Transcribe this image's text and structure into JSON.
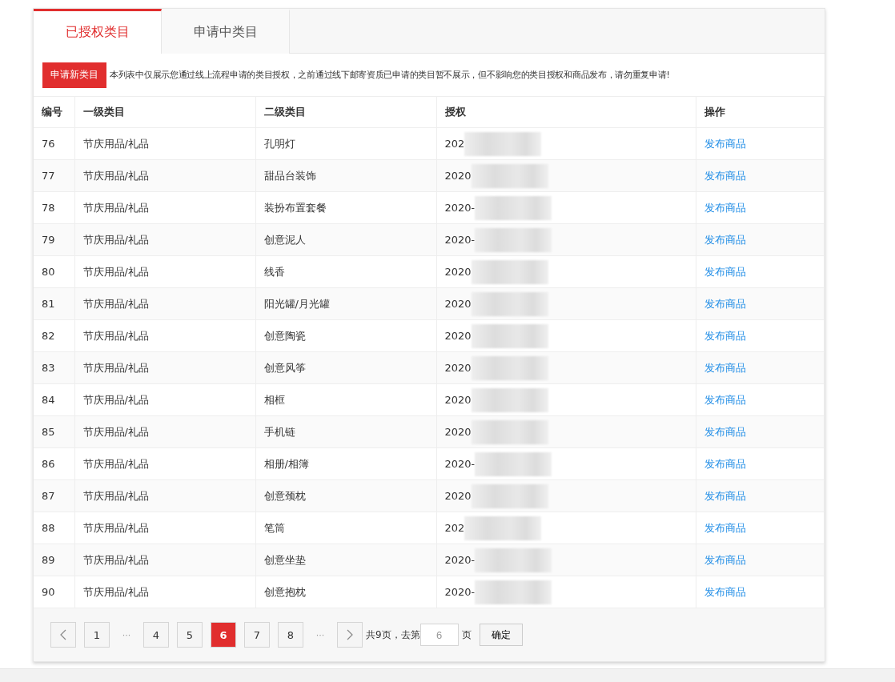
{
  "tabs": [
    {
      "label": "已授权类目",
      "selected": true
    },
    {
      "label": "申请中类目",
      "selected": false
    }
  ],
  "notice": {
    "button": "申请新类目",
    "text": "本列表中仅展示您通过线上流程申请的类目授权，之前通过线下邮寄资质已申请的类目暂不展示，但不影响您的类目授权和商品发布，请勿重复申请!"
  },
  "table": {
    "columns": [
      "编号",
      "一级类目",
      "二级类目",
      "授权",
      "操作"
    ],
    "rows": [
      {
        "id": "76",
        "level1": "节庆用品/礼品",
        "level2": "孔明灯",
        "date": "202",
        "action": "发布商品"
      },
      {
        "id": "77",
        "level1": "节庆用品/礼品",
        "level2": "甜品台装饰",
        "date": "2020",
        "action": "发布商品"
      },
      {
        "id": "78",
        "level1": "节庆用品/礼品",
        "level2": "装扮布置套餐",
        "date": "2020-",
        "action": "发布商品"
      },
      {
        "id": "79",
        "level1": "节庆用品/礼品",
        "level2": "创意泥人",
        "date": "2020-",
        "action": "发布商品"
      },
      {
        "id": "80",
        "level1": "节庆用品/礼品",
        "level2": "线香",
        "date": "2020",
        "action": "发布商品"
      },
      {
        "id": "81",
        "level1": "节庆用品/礼品",
        "level2": "阳光罐/月光罐",
        "date": "2020",
        "action": "发布商品"
      },
      {
        "id": "82",
        "level1": "节庆用品/礼品",
        "level2": "创意陶瓷",
        "date": "2020",
        "action": "发布商品"
      },
      {
        "id": "83",
        "level1": "节庆用品/礼品",
        "level2": "创意风筝",
        "date": "2020",
        "action": "发布商品"
      },
      {
        "id": "84",
        "level1": "节庆用品/礼品",
        "level2": "相框",
        "date": "2020",
        "action": "发布商品"
      },
      {
        "id": "85",
        "level1": "节庆用品/礼品",
        "level2": "手机链",
        "date": "2020",
        "action": "发布商品"
      },
      {
        "id": "86",
        "level1": "节庆用品/礼品",
        "level2": "相册/相簿",
        "date": "2020-",
        "action": "发布商品"
      },
      {
        "id": "87",
        "level1": "节庆用品/礼品",
        "level2": "创意颈枕",
        "date": "2020",
        "action": "发布商品"
      },
      {
        "id": "88",
        "level1": "节庆用品/礼品",
        "level2": "笔筒",
        "date": "202",
        "action": "发布商品"
      },
      {
        "id": "89",
        "level1": "节庆用品/礼品",
        "level2": "创意坐垫",
        "date": "2020-",
        "action": "发布商品"
      },
      {
        "id": "90",
        "level1": "节庆用品/礼品",
        "level2": "创意抱枕",
        "date": "2020-",
        "action": "发布商品"
      }
    ]
  },
  "pagination": {
    "items": [
      {
        "kind": "prev"
      },
      {
        "kind": "page",
        "label": "1",
        "selected": false
      },
      {
        "kind": "ellipsis",
        "label": "···"
      },
      {
        "kind": "page",
        "label": "4",
        "selected": false
      },
      {
        "kind": "page",
        "label": "5",
        "selected": false
      },
      {
        "kind": "page",
        "label": "6",
        "selected": true
      },
      {
        "kind": "page",
        "label": "7",
        "selected": false
      },
      {
        "kind": "page",
        "label": "8",
        "selected": false
      },
      {
        "kind": "ellipsis",
        "label": "···"
      },
      {
        "kind": "next"
      }
    ],
    "total": "共9页，去第",
    "goto_value": "6",
    "unit": "页",
    "confirm": "确定"
  }
}
